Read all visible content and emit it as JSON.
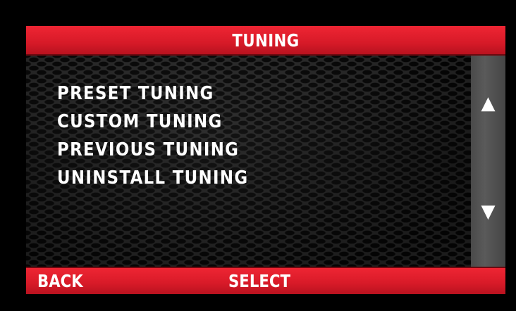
{
  "header": {
    "title": "TUNING"
  },
  "menu": {
    "items": [
      {
        "label": "PRESET TUNING"
      },
      {
        "label": "CUSTOM TUNING"
      },
      {
        "label": "PREVIOUS TUNING"
      },
      {
        "label": "UNINSTALL TUNING"
      }
    ]
  },
  "scroll": {
    "up_icon": "▲",
    "down_icon": "▼"
  },
  "footer": {
    "back_label": "BACK",
    "select_label": "SELECT"
  },
  "colors": {
    "accent_red": "#d71a28",
    "background": "#000000",
    "scroll_column": "#525252",
    "text": "#ffffff"
  }
}
